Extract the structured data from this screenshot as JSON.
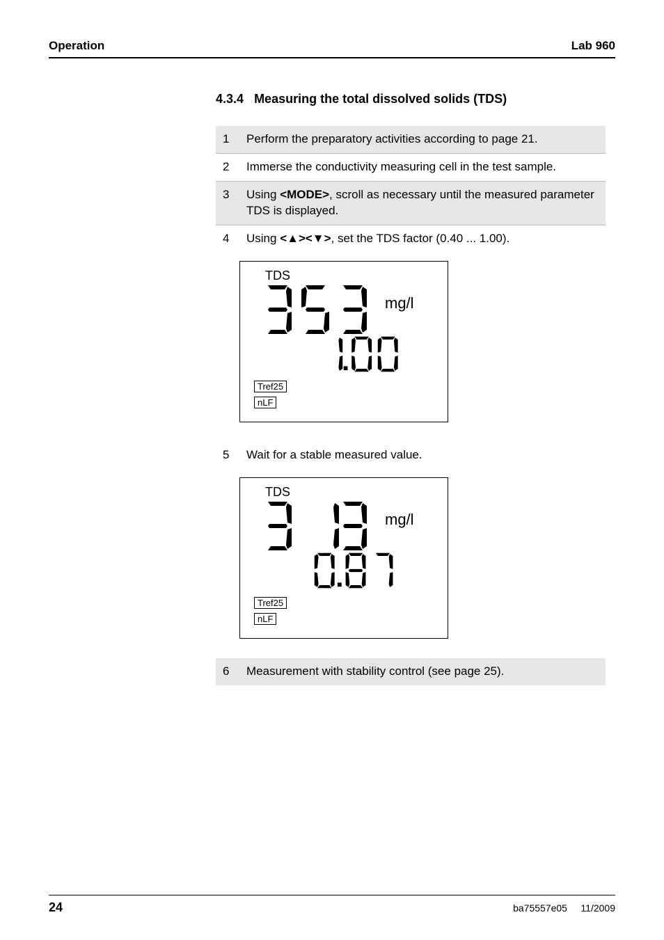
{
  "header": {
    "left": "Operation",
    "right": "Lab 960"
  },
  "section": {
    "num": "4.3.4",
    "title": "Measuring the total dissolved solids (TDS)"
  },
  "stepsA": [
    {
      "n": "1",
      "text_pre": "Perform the preparatory activities according to page 21.",
      "bold": "",
      "text_post": ""
    },
    {
      "n": "2",
      "text_pre": "Immerse the conductivity measuring cell in the test sample.",
      "bold": "",
      "text_post": ""
    },
    {
      "n": "3",
      "text_pre": "Using ",
      "bold": "<MODE>",
      "text_post": ", scroll as necessary until the measured parameter TDS is displayed."
    },
    {
      "n": "4",
      "text_pre": "Using ",
      "bold": "<▲><▼>",
      "text_post": ", set the TDS factor (0.40 ... 1.00)."
    }
  ],
  "lcd1": {
    "tds": "TDS",
    "big": "353",
    "unit": "mg/l",
    "small": "1.00",
    "tag1": "Tref25",
    "tag2": "nLF"
  },
  "stepsB": [
    {
      "n": "5",
      "text_pre": "Wait for a stable measured value.",
      "bold": "",
      "text_post": ""
    }
  ],
  "lcd2": {
    "tds": "TDS",
    "big": "313",
    "unit": "mg/l",
    "small": "0.87",
    "tag1": "Tref25",
    "tag2": "nLF"
  },
  "stepsC": [
    {
      "n": "6",
      "text_pre": "Measurement with stability control (see page 25).",
      "bold": "",
      "text_post": ""
    }
  ],
  "footer": {
    "page": "24",
    "doc": "ba75557e05",
    "date": "11/2009"
  },
  "chart_data": [
    {
      "type": "table",
      "title": "LCD display 1 (TDS factor setting)",
      "rows": [
        {
          "label": "Mode",
          "value": "TDS"
        },
        {
          "label": "Primary reading",
          "value": 353,
          "unit": "mg/l"
        },
        {
          "label": "TDS factor",
          "value": 1.0
        },
        {
          "label": "Tag",
          "value": "Tref25"
        },
        {
          "label": "Tag",
          "value": "nLF"
        }
      ]
    },
    {
      "type": "table",
      "title": "LCD display 2 (stable measured value)",
      "rows": [
        {
          "label": "Mode",
          "value": "TDS"
        },
        {
          "label": "Primary reading",
          "value": 313,
          "unit": "mg/l"
        },
        {
          "label": "TDS factor",
          "value": 0.87
        },
        {
          "label": "Tag",
          "value": "Tref25"
        },
        {
          "label": "Tag",
          "value": "nLF"
        }
      ]
    }
  ]
}
